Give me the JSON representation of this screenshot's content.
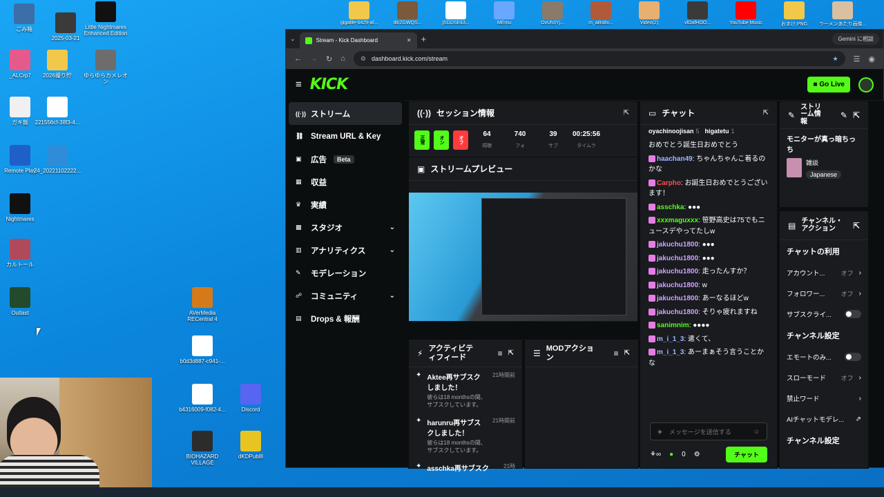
{
  "desktop": {
    "icons": [
      {
        "label": "ごみ箱",
        "color": "#3c6ea8"
      },
      {
        "label": "2025-03-21",
        "color": "#3a3a3a"
      },
      {
        "label": "Little Nightmares Enhanced Edition",
        "color": "#111111"
      },
      {
        "label": "_ALCrp7",
        "color": "#e65a8b"
      },
      {
        "label": "2026撮り貯",
        "color": "#f2c84b"
      },
      {
        "label": "ゆらゆらカメレオン",
        "color": "#6d6d6d"
      },
      {
        "label": "ガキ飯",
        "color": "#f0f0f0"
      },
      {
        "label": "221556cf-38f3-4...",
        "color": "#ffffff"
      },
      {
        "label": "Remote Play",
        "color": "#1f5fc8"
      },
      {
        "label": "24_20221102222...",
        "color": "#2f8cd8"
      },
      {
        "label": "Nightmares",
        "color": "#111111"
      },
      {
        "label": "カルトール",
        "color": "#b04a5a"
      },
      {
        "label": "Outlast",
        "color": "#234a2a"
      },
      {
        "label": "AVerMedia RECentral 4",
        "color": "#d47a1a"
      },
      {
        "label": "b0d3d887-c941-...",
        "color": "#ffffff"
      },
      {
        "label": "b4316009-f082-4...",
        "color": "#ffffff"
      },
      {
        "label": "Discord",
        "color": "#5865f2"
      },
      {
        "label": "BIOHAZARD VILLAGE",
        "color": "#2c2c2c"
      },
      {
        "label": "dKDPub8l",
        "color": "#e8c422"
      }
    ],
    "top_icons": [
      {
        "label": "gigafile-0429-af...",
        "color": "#f2c84b"
      },
      {
        "label": "IBrZGWQS...",
        "color": "#7a5a3a"
      },
      {
        "label": "jSGDSEk3...",
        "color": "#ffffff"
      },
      {
        "label": "MEmu",
        "color": "#6aa7ff"
      },
      {
        "label": "OvUh3Yj...",
        "color": "#8a7a6a"
      },
      {
        "label": "m_aBsBx...",
        "color": "#b05a3a"
      },
      {
        "label": "Video(2)",
        "color": "#e8b070"
      },
      {
        "label": "vlOafHOO...",
        "color": "#3a3a3a"
      },
      {
        "label": "YouTube Music",
        "color": "#ff0000"
      },
      {
        "label": "おまけ.PNG",
        "color": "#f2c84b"
      },
      {
        "label": "ラーメンあたり画像...",
        "color": "#d8c0a0"
      }
    ]
  },
  "browser": {
    "tab_title": "Stream - Kick Dashboard",
    "url": "dashboard.kick.com/stream",
    "gemini_label": "Gemini に相談"
  },
  "kick": {
    "logo": "KICK",
    "go_live": "Go Live",
    "nav": [
      {
        "label": "ストリーム",
        "icon": "broadcast-icon",
        "glyph": "((·))",
        "active": true
      },
      {
        "label": "Stream URL & Key",
        "icon": "link-icon",
        "glyph": "⛓",
        "active": false
      },
      {
        "label": "広告",
        "icon": "ad-icon",
        "glyph": "▣",
        "active": false,
        "badge": "Beta"
      },
      {
        "label": "収益",
        "icon": "revenue-icon",
        "glyph": "▦",
        "active": false
      },
      {
        "label": "実績",
        "icon": "trophy-icon",
        "glyph": "♛",
        "active": false
      },
      {
        "label": "スタジオ",
        "icon": "studio-icon",
        "glyph": "▩",
        "active": false,
        "chevron": true
      },
      {
        "label": "アナリティクス",
        "icon": "analytics-icon",
        "glyph": "▥",
        "active": false,
        "chevron": true
      },
      {
        "label": "モデレーション",
        "icon": "wrench-icon",
        "glyph": "✎",
        "active": false
      },
      {
        "label": "コミュニティ",
        "icon": "community-icon",
        "glyph": "☍",
        "active": false,
        "chevron": true
      },
      {
        "label": "Drops & 報酬",
        "icon": "drops-icon",
        "glyph": "▤",
        "active": false
      }
    ],
    "session": {
      "title": "セッション情報",
      "chips": [
        {
          "label": "正常",
          "color": "#53fc18"
        },
        {
          "label": "オン",
          "color": "#53fc18"
        },
        {
          "label": "オフ",
          "color": "#ff3b3b"
        }
      ],
      "stats": [
        {
          "value": "64",
          "label": "視聴"
        },
        {
          "value": "740",
          "label": "フォ"
        },
        {
          "value": "39",
          "label": "サブ"
        },
        {
          "value": "00:25:56",
          "label": "タイムラ"
        }
      ]
    },
    "preview": {
      "title": "ストリームプレビュー"
    },
    "activity": {
      "title": "アクティビティフィード",
      "items": [
        {
          "title": "Aktee再サブスクしました！",
          "sub": "彼らは18 monthsの間、サブスクしています。",
          "time": "21時間前"
        },
        {
          "title": "harunru再サブスクしました！",
          "sub": "彼らは18 monthsの間、サブスクしています。",
          "time": "21時間前"
        },
        {
          "title": "asschka再サブスク",
          "sub": "",
          "time": "21時"
        }
      ]
    },
    "mod": {
      "title": "MODアクション"
    },
    "chat": {
      "title": "チャット",
      "top_users": [
        {
          "name": "oyachinoojisan",
          "count": "5"
        },
        {
          "name": "higatetu",
          "count": "1"
        }
      ],
      "messages": [
        {
          "user": "",
          "cls": "",
          "text": "おめでとう誕生日おめでとう"
        },
        {
          "user": "haachan49",
          "cls": "u1",
          "text": ": ちゃんちゃんこ着るのかな"
        },
        {
          "user": "Carpho",
          "cls": "u3",
          "text": ": お誕生日おめでとうございます！"
        },
        {
          "user": "asschka",
          "cls": "u2",
          "text": ": ●●●"
        },
        {
          "user": "xxxmaguxxx",
          "cls": "u2",
          "text": ": 笹野高史は75でもニュースデやってたしw"
        },
        {
          "user": "jakuchu1800",
          "cls": "u4",
          "text": ": ●●●"
        },
        {
          "user": "jakuchu1800",
          "cls": "u4",
          "text": ": ●●●"
        },
        {
          "user": "jakuchu1800",
          "cls": "u4",
          "text": ": 走ったんすか？"
        },
        {
          "user": "jakuchu1800",
          "cls": "u4",
          "text": ": w"
        },
        {
          "user": "jakuchu1800",
          "cls": "u4",
          "text": ": あーなるほどw"
        },
        {
          "user": "jakuchu1800",
          "cls": "u4",
          "text": ": そりゃ疲れますね"
        },
        {
          "user": "sanimnim",
          "cls": "u2",
          "text": ": ●●●●"
        },
        {
          "user": "m_i_1_3",
          "cls": "u1",
          "text": ": 遣くて、"
        },
        {
          "user": "m_i_1_3",
          "cls": "u1",
          "text": ": あーまぁそう言うことかな"
        }
      ],
      "input_placeholder": "メッセージを送信する",
      "send_label": "チャット",
      "count": "0"
    },
    "stream_info": {
      "title": "ストリーム情報",
      "stream_title": "モニターが真っ暗ちっち",
      "category": "雑談",
      "language": "Japanese"
    },
    "channel_actions": {
      "title": "チャンネル・アクション",
      "section1": "チャットの利用",
      "rows1": [
        {
          "label": "アカウント...",
          "value": "オフ",
          "type": "arrow"
        },
        {
          "label": "フォロワー...",
          "value": "オフ",
          "type": "arrow"
        },
        {
          "label": "サブスクライ...",
          "value": "",
          "type": "toggle"
        }
      ],
      "section2": "チャンネル設定",
      "rows2": [
        {
          "label": "エモートのみ...",
          "value": "",
          "type": "toggle"
        },
        {
          "label": "スローモード",
          "value": "オフ",
          "type": "arrow"
        },
        {
          "label": "禁止ワード",
          "value": "",
          "type": "arrow"
        },
        {
          "label": "AIチャットモデレ...",
          "value": "",
          "type": "ext"
        }
      ],
      "section3": "チャンネル設定"
    }
  }
}
